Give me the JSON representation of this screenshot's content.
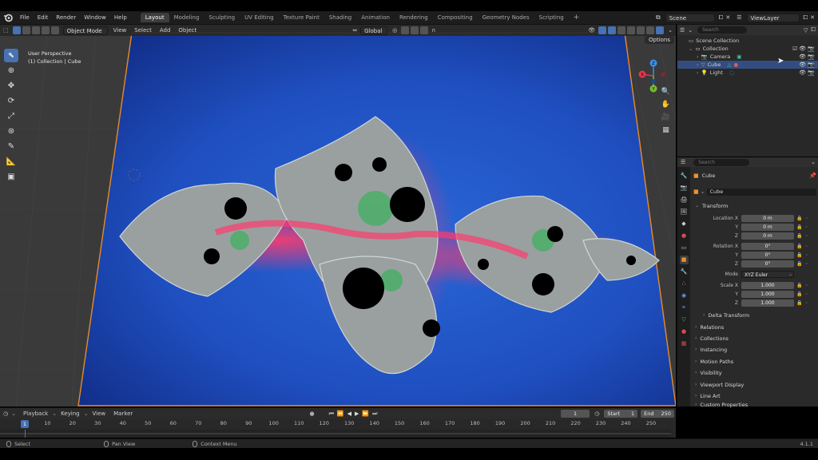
{
  "menu": [
    "File",
    "Edit",
    "Render",
    "Window",
    "Help"
  ],
  "workspaces": [
    "Layout",
    "Modeling",
    "Sculpting",
    "UV Editing",
    "Texture Paint",
    "Shading",
    "Animation",
    "Rendering",
    "Compositing",
    "Geometry Nodes",
    "Scripting"
  ],
  "active_workspace": "Layout",
  "scene": {
    "name": "Scene",
    "view_layer": "ViewLayer"
  },
  "viewport": {
    "mode": "Object Mode",
    "menus": [
      "View",
      "Select",
      "Add",
      "Object"
    ],
    "transform_orientation": "Global",
    "info_line1": "User Perspective",
    "info_line2": "(1) Collection | Cube",
    "options_label": "Options",
    "gizmo": {
      "x": "X",
      "y": "Y",
      "z": "Z"
    }
  },
  "outliner": {
    "search_placeholder": "Search",
    "items": [
      {
        "label": "Scene Collection",
        "level": 0
      },
      {
        "label": "Collection",
        "level": 1
      },
      {
        "label": "Camera",
        "level": 2
      },
      {
        "label": "Cube",
        "level": 2,
        "selected": true
      },
      {
        "label": "Light",
        "level": 2
      }
    ]
  },
  "properties": {
    "search_placeholder": "Search",
    "object_name": "Cube",
    "object_field": "Cube",
    "transform_title": "Transform",
    "location": {
      "label_x": "Location X",
      "x": "0 m",
      "y": "0 m",
      "z": "0 m"
    },
    "rotation": {
      "label_x": "Rotation X",
      "x": "0°",
      "y": "0°",
      "z": "0°"
    },
    "mode_label": "Mode",
    "mode_value": "XYZ Euler",
    "scale": {
      "label_x": "Scale X",
      "x": "1.000",
      "y": "1.000",
      "z": "1.000"
    },
    "axis_y": "Y",
    "axis_z": "Z",
    "delta_transform": "Delta Transform",
    "panels": [
      "Relations",
      "Collections",
      "Instancing",
      "Motion Paths",
      "Visibility",
      "Viewport Display",
      "Line Art",
      "Custom Properties"
    ]
  },
  "timeline": {
    "menus": [
      "Playback",
      "Keying",
      "View",
      "Marker"
    ],
    "current_frame": "1",
    "start_label": "Start",
    "start": "1",
    "end_label": "End",
    "end": "250",
    "ticks": [
      "1",
      "10",
      "20",
      "30",
      "40",
      "50",
      "60",
      "70",
      "80",
      "90",
      "100",
      "110",
      "120",
      "130",
      "140",
      "150",
      "160",
      "170",
      "180",
      "190",
      "200",
      "210",
      "220",
      "230",
      "240",
      "250"
    ]
  },
  "statusbar": {
    "select": "Select",
    "pan_view": "Pan View",
    "context_menu": "Context Menu",
    "version": "4.1.1"
  },
  "colors": {
    "accent": "#4772b3",
    "plane_blue": "#1f4fc0",
    "selected_row": "#334d80"
  }
}
